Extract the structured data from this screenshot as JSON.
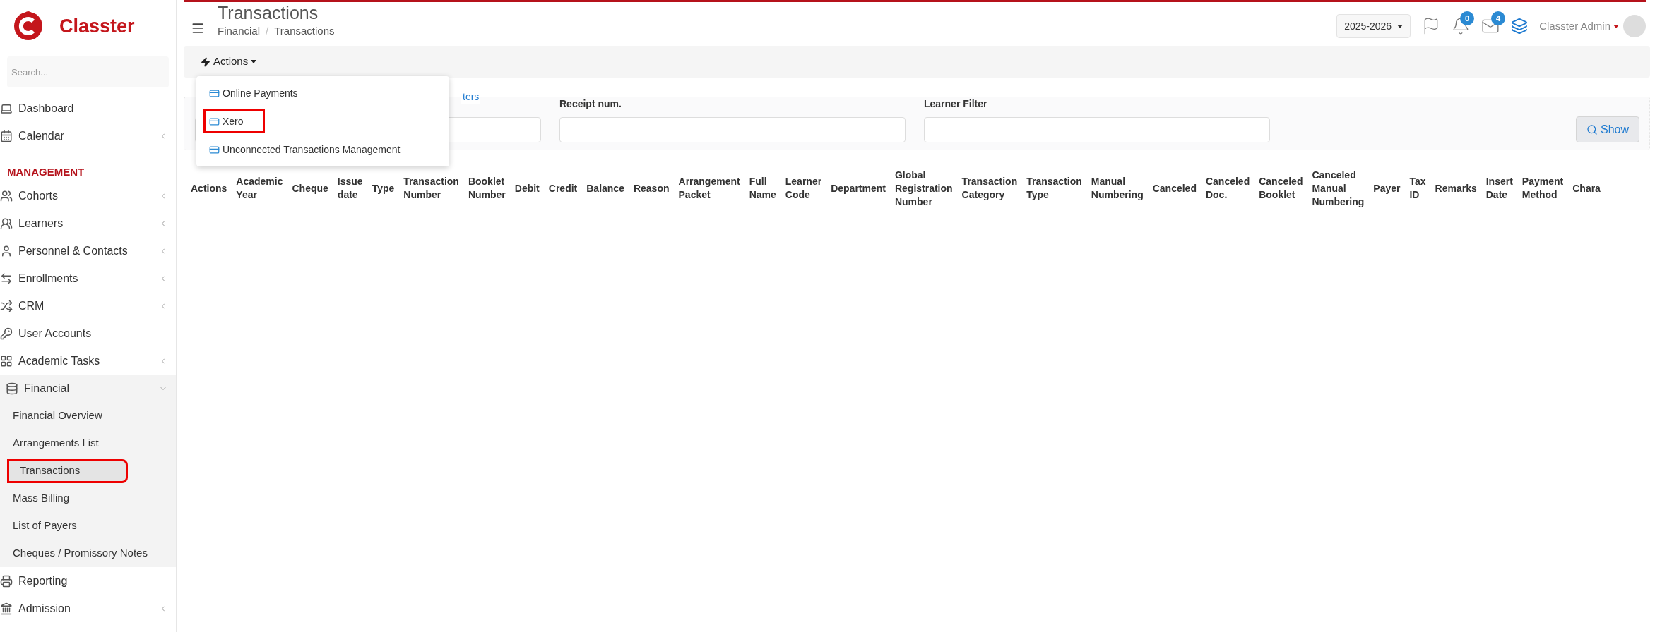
{
  "sidebar": {
    "logo": "Classter",
    "search": {
      "placeholder": "Search..."
    },
    "items": [
      {
        "kind": "link",
        "label": "Dashboard"
      },
      {
        "kind": "menu",
        "label": "Calendar",
        "expanded": false
      },
      {
        "kind": "section",
        "label": "MANAGEMENT"
      },
      {
        "kind": "menu",
        "label": "Cohorts",
        "expanded": false
      },
      {
        "kind": "menu",
        "label": "Learners",
        "expanded": false
      },
      {
        "kind": "menu",
        "label": "Personnel & Contacts",
        "expanded": false
      },
      {
        "kind": "menu",
        "label": "Enrollments",
        "expanded": false
      },
      {
        "kind": "menu",
        "label": "CRM",
        "expanded": false
      },
      {
        "kind": "link",
        "label": "User Accounts"
      },
      {
        "kind": "menu",
        "label": "Academic Tasks",
        "expanded": false
      },
      {
        "kind": "menu",
        "label": "Financial",
        "expanded": true,
        "children": [
          {
            "label": "Financial Overview",
            "selected": false,
            "highlighted": false
          },
          {
            "label": "Arrangements List",
            "selected": false,
            "highlighted": false
          },
          {
            "label": "Transactions",
            "selected": true,
            "highlighted": true
          },
          {
            "label": "Mass Billing",
            "selected": false,
            "highlighted": false
          },
          {
            "label": "List of Payers",
            "selected": false,
            "highlighted": false
          },
          {
            "label": "Cheques / Promissory Notes",
            "selected": false,
            "highlighted": false
          }
        ]
      },
      {
        "kind": "link",
        "label": "Reporting"
      },
      {
        "kind": "menu",
        "label": "Admission",
        "expanded": false
      }
    ]
  },
  "header": {
    "title": "Transactions",
    "breadcrumb": [
      "Financial",
      "Transactions"
    ],
    "breadcrumb_separator": "/",
    "year": "2025-2026",
    "notifications": "0",
    "messages": "4",
    "user": "Classter Admin"
  },
  "toolbar": {
    "actions": "Actions",
    "menu": [
      {
        "label": "Online Payments",
        "highlighted": false
      },
      {
        "label": "Xero",
        "highlighted": true
      },
      {
        "label": "Unconnected Transactions Management",
        "highlighted": false
      }
    ]
  },
  "filters": {
    "link": "ters",
    "fields": [
      {
        "label": "Receipt num."
      },
      {
        "label": "Learner Filter"
      }
    ],
    "button": "Show"
  },
  "table": {
    "columns": [
      "Actions",
      "Academic Year",
      "Cheque",
      "Issue date",
      "Type",
      "Transaction Number",
      "Booklet Number",
      "Debit",
      "Credit",
      "Balance",
      "Reason",
      "Arrangement Packet",
      "Full Name",
      "Learner Code",
      "Department",
      "Global Registration Number",
      "Transaction Category",
      "Transaction Type",
      "Manual Numbering",
      "Canceled",
      "Canceled Doc.",
      "Canceled Booklet",
      "Canceled Manual Numbering",
      "Payer",
      "Tax ID",
      "Remarks",
      "Insert Date",
      "Payment Method",
      "Chara"
    ]
  }
}
